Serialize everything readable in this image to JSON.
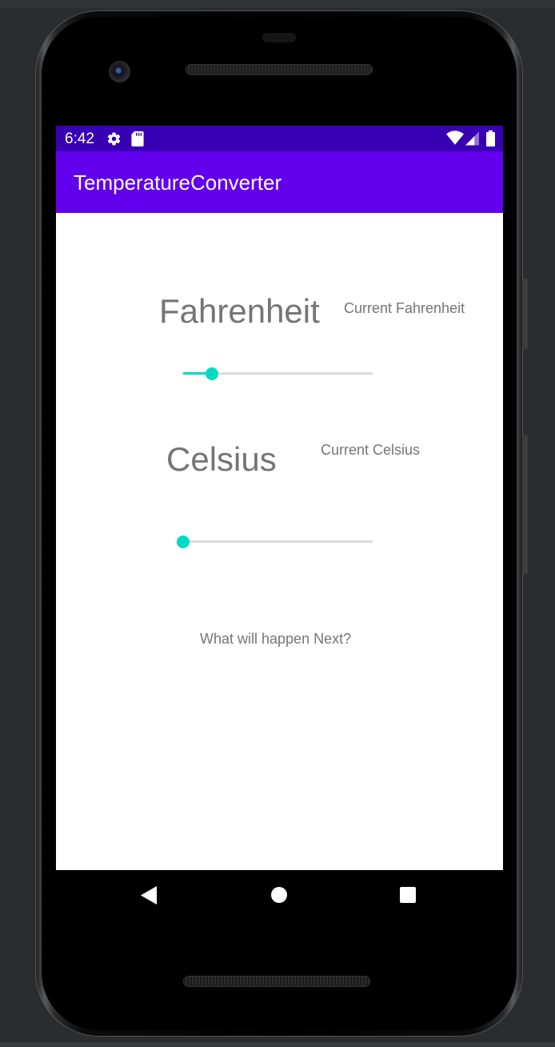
{
  "status_bar": {
    "time": "6:42",
    "left_icons": [
      "gear-icon",
      "sd-card-icon"
    ],
    "right_icons": [
      "wifi-icon",
      "cell-signal-icon",
      "battery-icon"
    ]
  },
  "app_bar": {
    "title": "TemperatureConverter",
    "color": "#6200ee",
    "status_color": "#3700b3"
  },
  "fahrenheit": {
    "label": "Fahrenheit",
    "current_label": "Current Fahrenheit",
    "slider_value_fraction": 0.15
  },
  "celsius": {
    "label": "Celsius",
    "current_label": "Current Celsius",
    "slider_value_fraction": 0.0
  },
  "message": "What will happen Next?",
  "accent_color": "#03dac5",
  "nav_bar": {
    "icons": [
      "back-icon",
      "home-icon",
      "recents-icon"
    ]
  }
}
